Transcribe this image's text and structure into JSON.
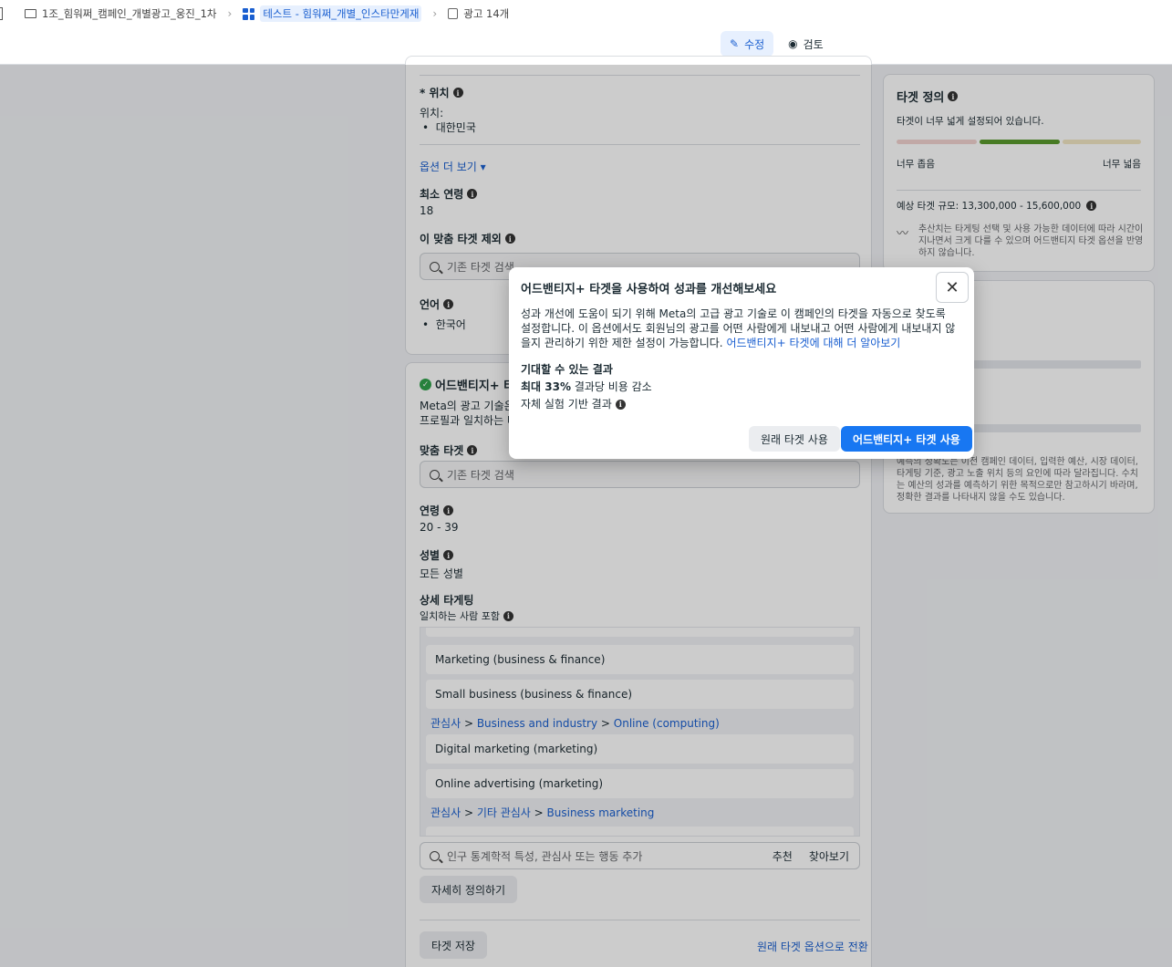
{
  "breadcrumb": {
    "campaign": "1조_힘워쩌_캠페인_개별광고_웅진_1차",
    "adset": "테스트 - 힘워쩌_개별_인스타만게재",
    "ads": "광고 14개"
  },
  "mode": {
    "edit": "수정",
    "review": "검토"
  },
  "location": {
    "label": "* 위치",
    "sub": "위치:",
    "value": "대한민국",
    "more_options": "옵션 더 보기"
  },
  "min_age": {
    "label": "최소 연령",
    "value": "18"
  },
  "exclude": {
    "label": "이 맞춤 타겟 제외",
    "placeholder": "기존 타겟 검색"
  },
  "language": {
    "label": "언어",
    "value": "한국어"
  },
  "advantage": {
    "title": "어드밴티지+ 타",
    "desc1": "Meta의 광고 기술은 ",
    "desc2": "프로필과 일치하는 타"
  },
  "custom_audience": {
    "label": "맞춤 타겟",
    "placeholder": "기존 타겟 검색"
  },
  "age": {
    "label": "연령",
    "value": "20 - 39"
  },
  "gender": {
    "label": "성별",
    "value": "모든 성별"
  },
  "detailed": {
    "label": "상세 타게팅",
    "sub": "일치하는 사람 포함",
    "chips1": [
      "Marketing (business & finance)",
      "Small business (business & finance)"
    ],
    "path1": [
      "관심사",
      "Business and industry",
      "Online (computing)"
    ],
    "chips2": [
      "Digital marketing (marketing)",
      "Online advertising (marketing)"
    ],
    "path2": [
      "관심사",
      "기타 관심사",
      "Business marketing"
    ],
    "partial": "Business marketing",
    "search_placeholder": "인구 통계학적 특성, 관심사 또는 행동 추가",
    "suggest": "추천",
    "browse": "찾아보기",
    "define_more": "자세히 정의하기"
  },
  "footer": {
    "save": "타겟 저장",
    "switch": "원래 타겟 옵션으로 전환"
  },
  "audience_def": {
    "title": "타겟 정의",
    "status": "타겟이 너무 넓게 설정되어 있습니다.",
    "narrow": "너무 좁음",
    "broad": "너무 넓음",
    "size_label": "예상 타겟 규모: 13,300,000 - 15,600,000",
    "note": "추산치는 타게팅 선택 및 사용 가능한 데이터에 따라 시간이 지나면서 크게 다를 수 있으며 어드밴티지 타겟 옵션을 반영하지 않습니다."
  },
  "estimate_note": "예측의 정확도는 이전 캠페인 데이터, 입력한 예산, 시장 데이터, 타게팅 기준, 광고 노출 위치 등의 요인에 따라 달라집니다. 수치는 예산의 성과를 예측하기 위한 목적으로만 참고하시기 바라며, 정확한 결과를 나타내지 않을 수도 있습니다.",
  "modal": {
    "title": "어드밴티지+ 타겟을 사용하여 성과를 개선해보세요",
    "body": "성과 개선에 도움이 되기 위해 Meta의 고급 광고 기술로 이 캠페인의 타겟을 자동으로 찾도록 설정합니다. 이 옵션에서도 회원님의 광고를 어떤 사람에게 내보내고 어떤 사람에게 내보내지 않을지 관리하기 위한 제한 설정이 가능합니다.",
    "learn_more": "어드밴티지+ 타겟에 대해 더 알아보기",
    "expect_title": "기대할 수 있는 결과",
    "stat_bold": "최대 33%",
    "stat_rest": "결과당 비용 감소",
    "basis": "자체 실험 기반 결과",
    "btn_original": "원래 타겟 사용",
    "btn_advantage": "어드밴티지+ 타겟 사용"
  },
  "colors": {
    "accent": "#1877f2",
    "good": "#5b9a2d"
  }
}
